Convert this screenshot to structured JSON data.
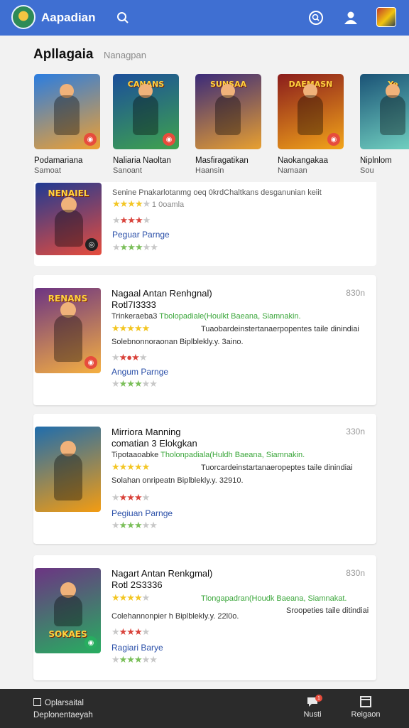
{
  "app": {
    "title": "Aapadian"
  },
  "section": {
    "title": "Apllagaia",
    "subtitle": "Nanagpan"
  },
  "carousel": [
    {
      "name": "Podamariana",
      "sub": "Samoat",
      "banner": "",
      "colors": [
        "#2a7de1",
        "#f0a030"
      ]
    },
    {
      "name": "Naliaria Naoltan",
      "sub": "Sanoant",
      "banner": "CANANS",
      "colors": [
        "#1b4e9b",
        "#3fa34d"
      ]
    },
    {
      "name": "Masfiragatikan",
      "sub": "Haansin",
      "banner": "SUNSAA",
      "colors": [
        "#3a2a7a",
        "#e8a030"
      ]
    },
    {
      "name": "Naokangakaa",
      "sub": "Namaan",
      "banner": "DAEMASN",
      "colors": [
        "#8a1c1c",
        "#f2a51a"
      ]
    },
    {
      "name": "Niplnlom",
      "sub": "Sou",
      "banner": "Ye",
      "colors": [
        "#1a5276",
        "#76d7c4"
      ]
    }
  ],
  "top_row": {
    "banner": "NENAIEL",
    "desc": "Senine Pnakarlotanmg oeq 0krdChaltkans desganunian keiit",
    "rating_label": "1 0oamla",
    "link": "Peguar Parnge",
    "colors": [
      "#1f3a93",
      "#e74c3c"
    ]
  },
  "items": [
    {
      "title": "Nagaal Antan Renhgnal)",
      "code": "Rotl7I3333",
      "time": "830n",
      "line1a": "Trinkeraeba3  ",
      "line1b": "Tbolopadiale(Houlkt Baeana, Siamnakin.",
      "line2": "Tuaobardeinstertanaerpopentes taile dinindiai",
      "line3": "Solebnonnoraonan Biplblekly.y. 3aino.",
      "link": "Angum Parnge",
      "banner": "RENANS",
      "colors": [
        "#6c3483",
        "#f5b041"
      ]
    },
    {
      "title": "Mirriora Manning",
      "code": "comatian 3 Elokgkan",
      "time": "330n",
      "line1a": "Tipotaaoabke  ",
      "line1b": "Tholonpadiala(Huldh Baeana, Siamnakin.",
      "line2": "Tuorcardeinstartanaeropeptes taile dinindiai",
      "line3": "Solahan onripeatn Biplblekly.y. 32910.",
      "link": "Pegiuan Parnge",
      "banner": "",
      "colors": [
        "#1f6dad",
        "#f39c12"
      ]
    },
    {
      "title": "Nagart Antan Renkgmal)",
      "code": "Rotl 2S3336",
      "time": "830n",
      "line1a": "",
      "line1b": "Tlongapadran(Houdk Baeana, Siamnakat.",
      "line2": "Sroopeties taile ditindiai",
      "line3": "Colehannonpier h Biplblekly.y. 22l0o.",
      "link": "Ragiari Barye",
      "banner": "SOKAES",
      "colors": [
        "#6c3483",
        "#27ae60"
      ]
    }
  ],
  "bottom": {
    "left_line1": "Oplarsaital",
    "left_line2": "Deplonentaeyah",
    "nav": [
      {
        "label": "Nusti",
        "badge": "1"
      },
      {
        "label": "Reigaon"
      }
    ]
  },
  "colors": {
    "topbar": "#3f6fd2",
    "link": "#2a4fa8",
    "star": "#f3c623"
  }
}
